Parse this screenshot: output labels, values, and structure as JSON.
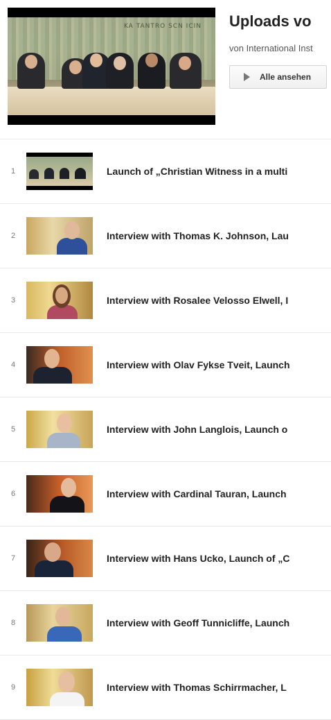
{
  "header": {
    "title": "Uploads vo",
    "subtitle": "von International Inst",
    "play_all_label": "Alle ansehen"
  },
  "videos": [
    {
      "index": "1",
      "title": "Launch of „Christian Witness in a multi"
    },
    {
      "index": "2",
      "title": "Interview with Thomas K. Johnson, Lau"
    },
    {
      "index": "3",
      "title": "Interview with Rosalee Velosso Elwell, I"
    },
    {
      "index": "4",
      "title": "Interview with Olav Fykse Tveit, Launch"
    },
    {
      "index": "5",
      "title": "Interview with John Langlois, Launch o"
    },
    {
      "index": "6",
      "title": "Interview with Cardinal Tauran, Launch"
    },
    {
      "index": "7",
      "title": "Interview with Hans Ucko, Launch of „C"
    },
    {
      "index": "8",
      "title": "Interview with Geoff Tunnicliffe, Launch"
    },
    {
      "index": "9",
      "title": "Interview with Thomas Schirrmacher, L"
    }
  ]
}
